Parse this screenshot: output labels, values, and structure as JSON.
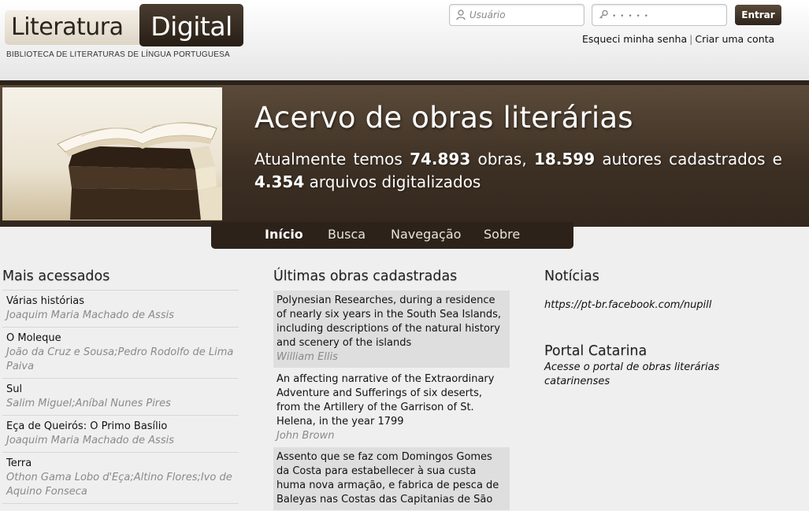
{
  "header": {
    "logo_part1": "Literatura",
    "logo_part2": "Digital",
    "tagline": "BIBLIOTECA DE LITERATURAS DE LÍNGUA PORTUGUESA",
    "username_placeholder": "Usuário",
    "password_placeholder": "• • • • •",
    "login_button": "Entrar",
    "forgot_password": "Esqueci minha senha",
    "separator": "|",
    "create_account": "Criar uma conta"
  },
  "banner": {
    "title": "Acervo de obras literárias",
    "sub_prefix": "Atualmente temos",
    "works_count": "74.893",
    "works_label": "obras,",
    "authors_count": "18.599",
    "authors_label": "autores cadastrados e",
    "files_count": "4.354",
    "files_label": "arquivos digitalizados"
  },
  "nav": {
    "items": [
      {
        "label": "Início"
      },
      {
        "label": "Busca"
      },
      {
        "label": "Navegação"
      },
      {
        "label": "Sobre"
      }
    ]
  },
  "most_accessed": {
    "title": "Mais acessados",
    "items": [
      {
        "title": "Várias histórias",
        "author": "Joaquim Maria Machado de Assis"
      },
      {
        "title": "O Moleque",
        "author": "João da Cruz e Sousa;Pedro Rodolfo de Lima Paiva"
      },
      {
        "title": "Sul",
        "author": "Salim Miguel;Aníbal Nunes Pires"
      },
      {
        "title": "Eça de Queirós: O Primo Basílio",
        "author": "Joaquim Maria Machado de Assis"
      },
      {
        "title": "Terra",
        "author": "Othon Gama Lobo d'Eça;Altino Flores;Ivo de Aquino Fonseca"
      }
    ]
  },
  "latest_works": {
    "title": "Últimas obras cadastradas",
    "items": [
      {
        "title": "Polynesian Researches, during a residence of nearly six years in the South Sea Islands, including descriptions of the natural history and scenery of the islands",
        "author": "William Ellis"
      },
      {
        "title": "An affecting narrative of the Extraordinary Adventure and Sufferings of six deserts, from the Artillery of the Garrison of St. Helena, in the year 1799",
        "author": "John Brown"
      },
      {
        "title": "Assento que se faz com Domingos Gomes da Costa para estabellecer à sua custa huma nova armação, e fabrica de pesca de Baleyas nas Costas das Capitanias de São",
        "author": ""
      }
    ]
  },
  "news": {
    "title": "Notícias",
    "link": "https://pt-br.facebook.com/nupill",
    "portal_title": "Portal Catarina",
    "portal_desc": "Acesse o portal de obras literárias catarinenses"
  }
}
